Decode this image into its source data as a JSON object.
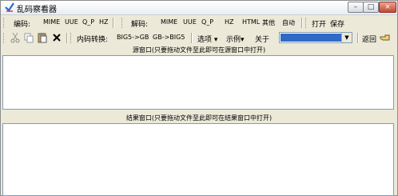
{
  "title": "乱码察看器",
  "window_controls": {
    "minimize": "–",
    "maximize": "□",
    "close": "×"
  },
  "toolbar1": {
    "encode_label": "编码:",
    "encode_buttons": [
      "MIME",
      "UUE",
      "Q_P",
      "HZ"
    ],
    "decode_label": "解码:",
    "decode_buttons": [
      "MIME",
      "UUE",
      "Q_P",
      "HZ",
      "HTML",
      "其他",
      "自动"
    ],
    "open": "打开",
    "save": "保存"
  },
  "toolbar2": {
    "edit_icons": [
      "cut-icon",
      "copy-icon",
      "paste-icon",
      "delete-icon"
    ],
    "convert_label": "内码转换:",
    "convert_buttons": [
      "BIG5->GB",
      "GB->BIG5"
    ],
    "options": "选项",
    "examples": "示例",
    "about": "关于",
    "back": "返回"
  },
  "source_pane": {
    "header": "源窗口(只要拖动文件至此即可在源窗口中打开)",
    "content": ""
  },
  "result_pane": {
    "header": "结果窗口(只要拖动文件至此即可在结果窗口中打开)",
    "content": ""
  },
  "colors": {
    "combo_selection": "#316ac5",
    "toolbar_bg": "#ece9d8"
  }
}
